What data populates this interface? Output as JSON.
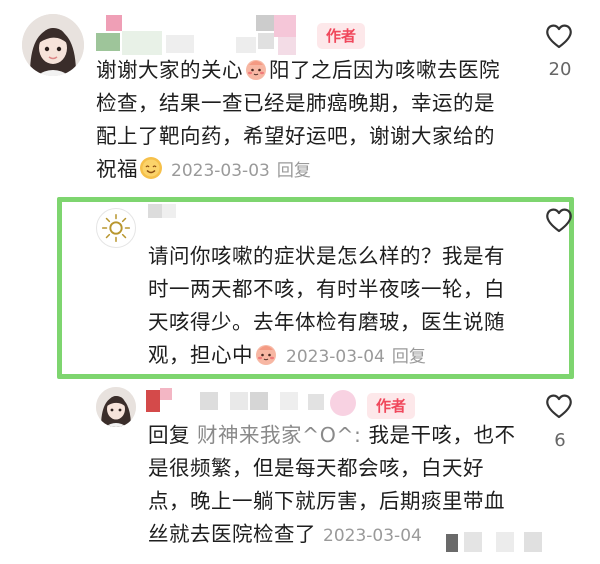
{
  "comments": [
    {
      "author_tag": "作者",
      "lines": [
        "谢谢大家的关心",
        "阳了之后因为咳嗽去医院",
        "检查，结果一查已经是肺癌晚期，幸运的是",
        "配上了靶向药，希望好运吧，谢谢大家给的",
        "祝福"
      ],
      "date": "2023-03-03",
      "reply_label": "回复",
      "likes": "20"
    },
    {
      "lines": [
        "请问你咳嗽的症状是怎么样的？我是有",
        "时一两天都不咳，有时半夜咳一轮，白",
        "天咳得少。去年体检有磨玻，医生说随",
        "观，担心中"
      ],
      "date": "2023-03-04",
      "reply_label": "回复"
    },
    {
      "author_tag": "作者",
      "reply_prefix": "回复",
      "reply_target": "财神来我家^O^:",
      "lines": [
        " 我是干咳，也不",
        "是很频繁，但是每天都会咳，白天好",
        "点，晚上一躺下就厉害，后期痰里带血",
        "丝就去医院检查了"
      ],
      "date": "2023-03-04",
      "likes": "6"
    }
  ],
  "colors": {
    "highlight": "#7ed56f",
    "author_tag_text": "#f0485c",
    "author_tag_bg": "#fde8ea",
    "meta": "#9a9a9a"
  },
  "icons": [
    "avatar-girl",
    "avatar-sun",
    "heart-outline-icon",
    "blush-face-emoji",
    "smile-emoji"
  ]
}
